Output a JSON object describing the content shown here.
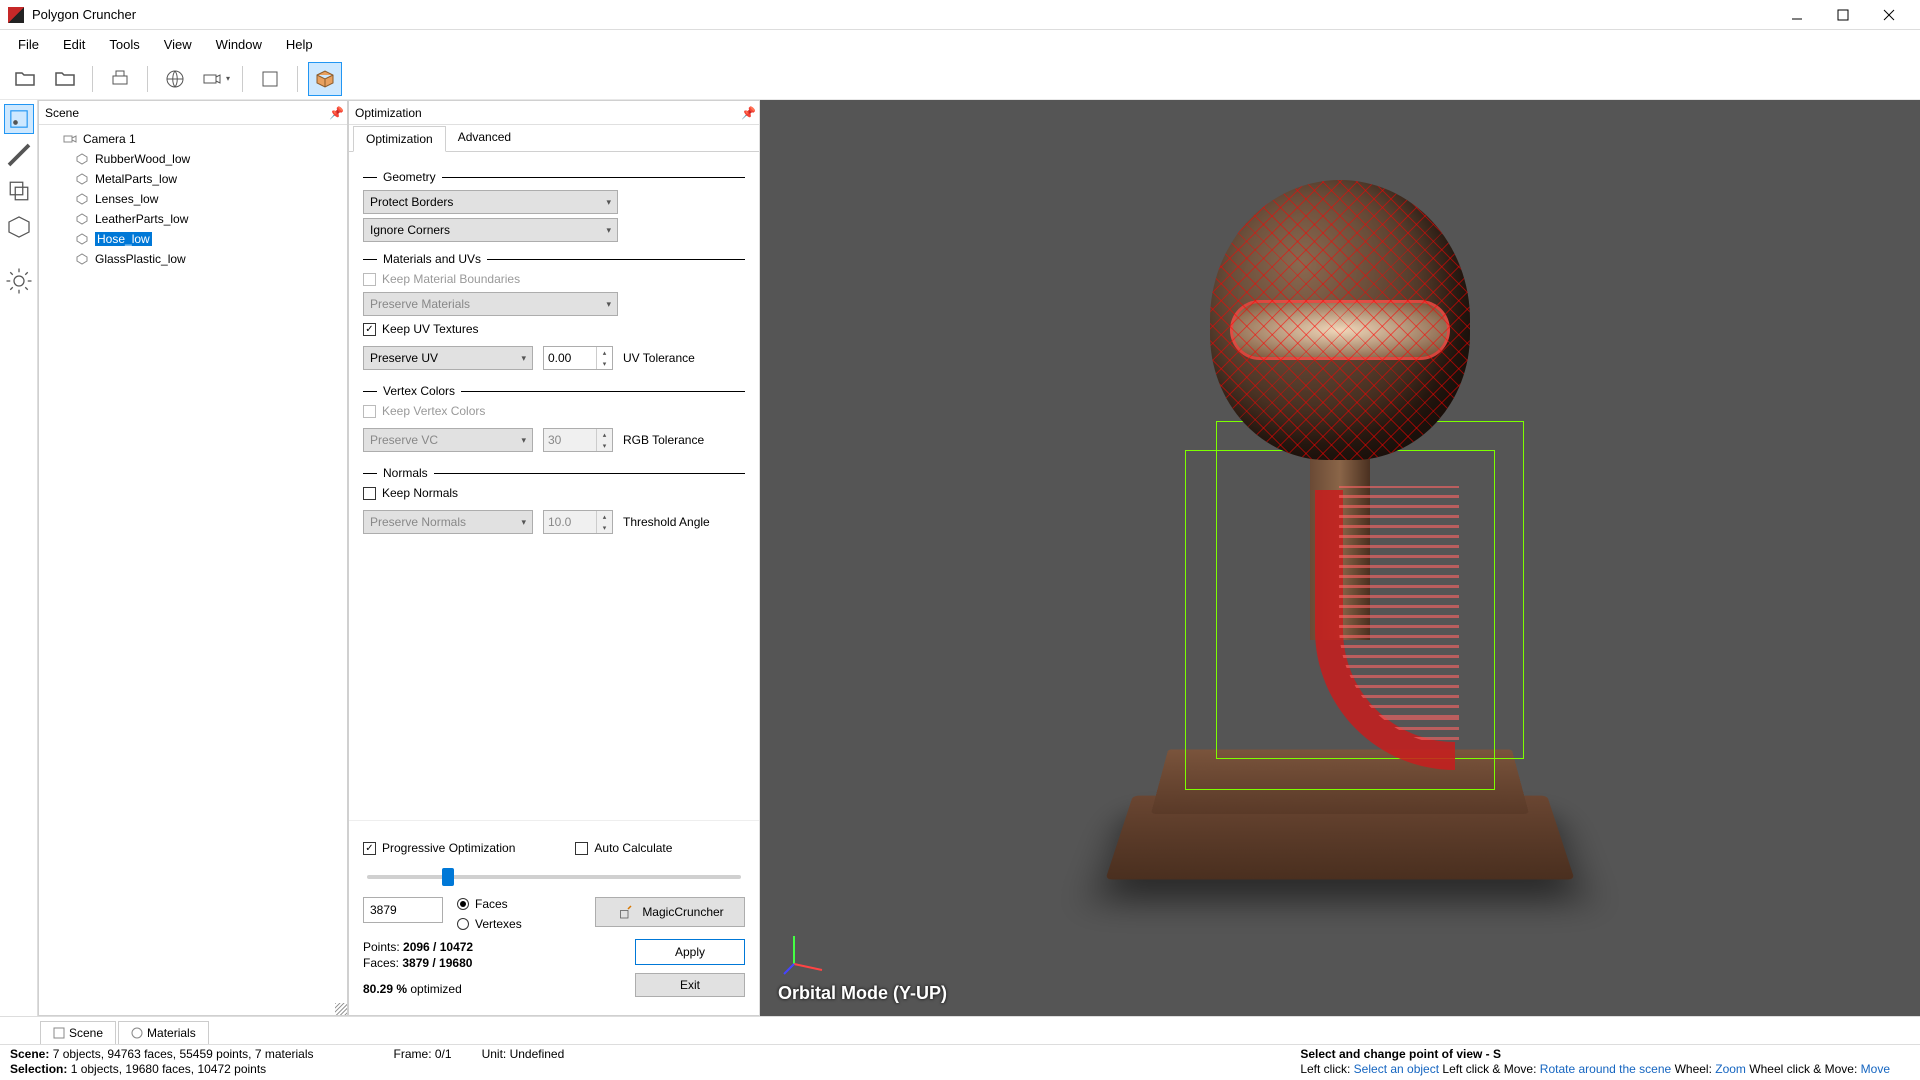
{
  "title": "Polygon Cruncher",
  "menu": [
    "File",
    "Edit",
    "Tools",
    "View",
    "Window",
    "Help"
  ],
  "scene_panel": {
    "title": "Scene"
  },
  "tree": [
    {
      "label": "Camera 1",
      "type": "camera",
      "sel": false
    },
    {
      "label": "RubberWood_low",
      "type": "mesh",
      "sel": false
    },
    {
      "label": "MetalParts_low",
      "type": "mesh",
      "sel": false
    },
    {
      "label": "Lenses_low",
      "type": "mesh",
      "sel": false
    },
    {
      "label": "LeatherParts_low",
      "type": "mesh",
      "sel": false
    },
    {
      "label": "Hose_low",
      "type": "mesh",
      "sel": true
    },
    {
      "label": "GlassPlastic_low",
      "type": "mesh",
      "sel": false
    }
  ],
  "opt_panel": {
    "title": "Optimization"
  },
  "opt_tabs": {
    "t1": "Optimization",
    "t2": "Advanced"
  },
  "sec": {
    "geometry": "Geometry",
    "materials": "Materials and UVs",
    "vertex": "Vertex Colors",
    "normals": "Normals"
  },
  "combo": {
    "borders": "Protect Borders",
    "corners": "Ignore Corners",
    "materials": "Preserve Materials",
    "uv": "Preserve UV",
    "vc": "Preserve VC",
    "normals": "Preserve Normals"
  },
  "chk": {
    "matbound": "Keep Material Boundaries",
    "keepuv": "Keep UV Textures",
    "keepvc": "Keep Vertex Colors",
    "keepnorm": "Keep Normals",
    "progressive": "Progressive Optimization",
    "autocalc": "Auto Calculate"
  },
  "lbl": {
    "uvtol": "UV Tolerance",
    "rgbtol": "RGB Tolerance",
    "threshang": "Threshold Angle",
    "faces": "Faces",
    "vertexes": "Vertexes",
    "magic": "MagicCruncher",
    "apply": "Apply",
    "exit": "Exit"
  },
  "val": {
    "uvtol": "0.00",
    "rgbtol": "30",
    "threshang": "10.0",
    "count": "3879"
  },
  "stats": {
    "points": "Points: ",
    "points_v": "2096 / 10472",
    "faces": "Faces: ",
    "faces_v": "3879 / 19680",
    "pct": "80.29 %",
    "opt": " optimized"
  },
  "bottom_tabs": {
    "scene": "Scene",
    "materials": "Materials"
  },
  "status": {
    "scene_l": "Scene:",
    "scene_v": "  7 objects,  94763 faces,  55459 points,  7 materials",
    "sel_l": "Selection:",
    "sel_v": "  1 objects,  19680 faces,  10472 points",
    "frame": "Frame: 0/1",
    "unit": "Unit: Undefined"
  },
  "hints": {
    "title": "Select and change point of view - S",
    "lc": "Left click: ",
    "lc_a": "Select an object",
    "lcm": " Left click & Move: ",
    "lcm_a": "Rotate around the scene",
    "wh": " Wheel: ",
    "wh_a": "Zoom",
    "whm": " Wheel click & Move: ",
    "whm_a": "Move"
  },
  "viewport": {
    "mode": "Orbital Mode (Y-UP)"
  }
}
